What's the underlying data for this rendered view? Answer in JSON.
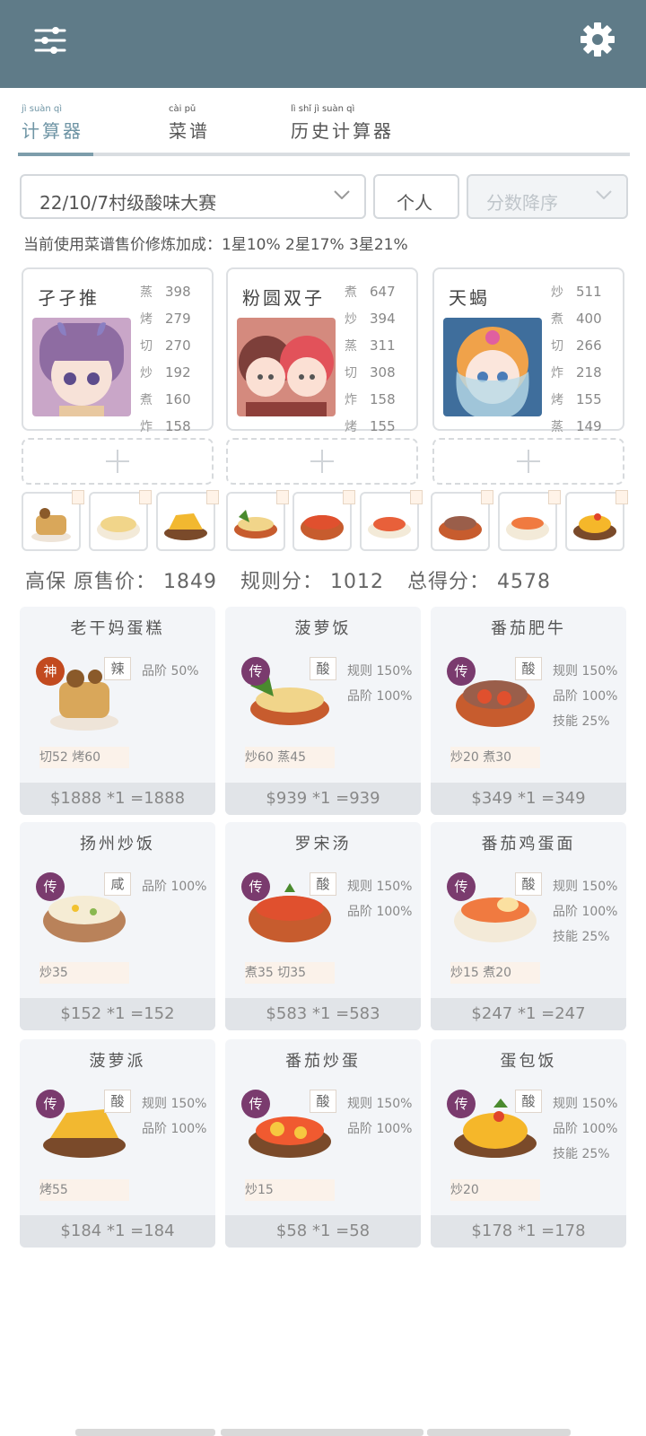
{
  "header": {
    "menu_icon": "sliders-icon",
    "settings_icon": "gear-icon"
  },
  "tabs": [
    {
      "pinyin": "jì suàn qì",
      "label": "计算器",
      "active": true
    },
    {
      "pinyin": "cài pǔ",
      "label": "菜谱",
      "active": false
    },
    {
      "pinyin": "lì shǐ jì suàn qì",
      "label": "历史计算器",
      "active": false
    }
  ],
  "controls": {
    "contest": "22/10/7村级酸味大赛",
    "mode": "个人",
    "sort": "分数降序"
  },
  "bonus_text": "当前使用菜谱售价修炼加成：1星10% 2星17% 3星21%",
  "chefs": [
    {
      "name": "孑孑推",
      "skills": [
        {
          "s": "蒸",
          "v": "398"
        },
        {
          "s": "烤",
          "v": "279"
        },
        {
          "s": "切",
          "v": "270"
        },
        {
          "s": "炒",
          "v": "192"
        },
        {
          "s": "煮",
          "v": "160"
        },
        {
          "s": "炸",
          "v": "158"
        }
      ]
    },
    {
      "name": "粉圆双子",
      "skills": [
        {
          "s": "煮",
          "v": "647"
        },
        {
          "s": "炒",
          "v": "394"
        },
        {
          "s": "蒸",
          "v": "311"
        },
        {
          "s": "切",
          "v": "308"
        },
        {
          "s": "炸",
          "v": "158"
        },
        {
          "s": "烤",
          "v": "155"
        }
      ]
    },
    {
      "name": "天蝎",
      "skills": [
        {
          "s": "炒",
          "v": "511"
        },
        {
          "s": "煮",
          "v": "400"
        },
        {
          "s": "切",
          "v": "266"
        },
        {
          "s": "炸",
          "v": "218"
        },
        {
          "s": "烤",
          "v": "155"
        },
        {
          "s": "蒸",
          "v": "149"
        }
      ]
    }
  ],
  "scores": {
    "base_price": "高保 原售价： 1849",
    "rule_score": "规则分： 1012",
    "total_score": "总得分： 4578"
  },
  "recipes": [
    {
      "name": "老干妈蛋糕",
      "rank": "神",
      "rank_color": "#c24a1f",
      "cond": "辣",
      "attrs": [
        "品阶 50%"
      ],
      "needs": "切52 烤60",
      "price": "$1888 *1 =1888"
    },
    {
      "name": "菠萝饭",
      "rank": "传",
      "rank_color": "#7a3b6e",
      "cond": "酸",
      "attrs": [
        "规则 150%",
        "品阶 100%"
      ],
      "needs": "炒60 蒸45",
      "price": "$939 *1 =939"
    },
    {
      "name": "番茄肥牛",
      "rank": "传",
      "rank_color": "#7a3b6e",
      "cond": "酸",
      "attrs": [
        "规则 150%",
        "品阶 100%",
        "技能 25%"
      ],
      "needs": "炒20 煮30",
      "price": "$349 *1 =349"
    },
    {
      "name": "扬州炒饭",
      "rank": "传",
      "rank_color": "#7a3b6e",
      "cond": "咸",
      "attrs": [
        "品阶 100%"
      ],
      "needs": "炒35",
      "price": "$152 *1 =152"
    },
    {
      "name": "罗宋汤",
      "rank": "传",
      "rank_color": "#7a3b6e",
      "cond": "酸",
      "attrs": [
        "规则 150%",
        "品阶 100%"
      ],
      "needs": "煮35 切35",
      "price": "$583 *1 =583"
    },
    {
      "name": "番茄鸡蛋面",
      "rank": "传",
      "rank_color": "#7a3b6e",
      "cond": "酸",
      "attrs": [
        "规则 150%",
        "品阶 100%",
        "技能 25%"
      ],
      "needs": "炒15 煮20",
      "price": "$247 *1 =247"
    },
    {
      "name": "菠萝派",
      "rank": "传",
      "rank_color": "#7a3b6e",
      "cond": "酸",
      "attrs": [
        "规则 150%",
        "品阶 100%"
      ],
      "needs": "烤55",
      "price": "$184 *1 =184"
    },
    {
      "name": "番茄炒蛋",
      "rank": "传",
      "rank_color": "#7a3b6e",
      "cond": "酸",
      "attrs": [
        "规则 150%",
        "品阶 100%"
      ],
      "needs": "炒15",
      "price": "$58 *1 =58"
    },
    {
      "name": "蛋包饭",
      "rank": "传",
      "rank_color": "#7a3b6e",
      "cond": "酸",
      "attrs": [
        "规则 150%",
        "品阶 100%",
        "技能 25%"
      ],
      "needs": "炒20",
      "price": "$178 *1 =178"
    }
  ]
}
